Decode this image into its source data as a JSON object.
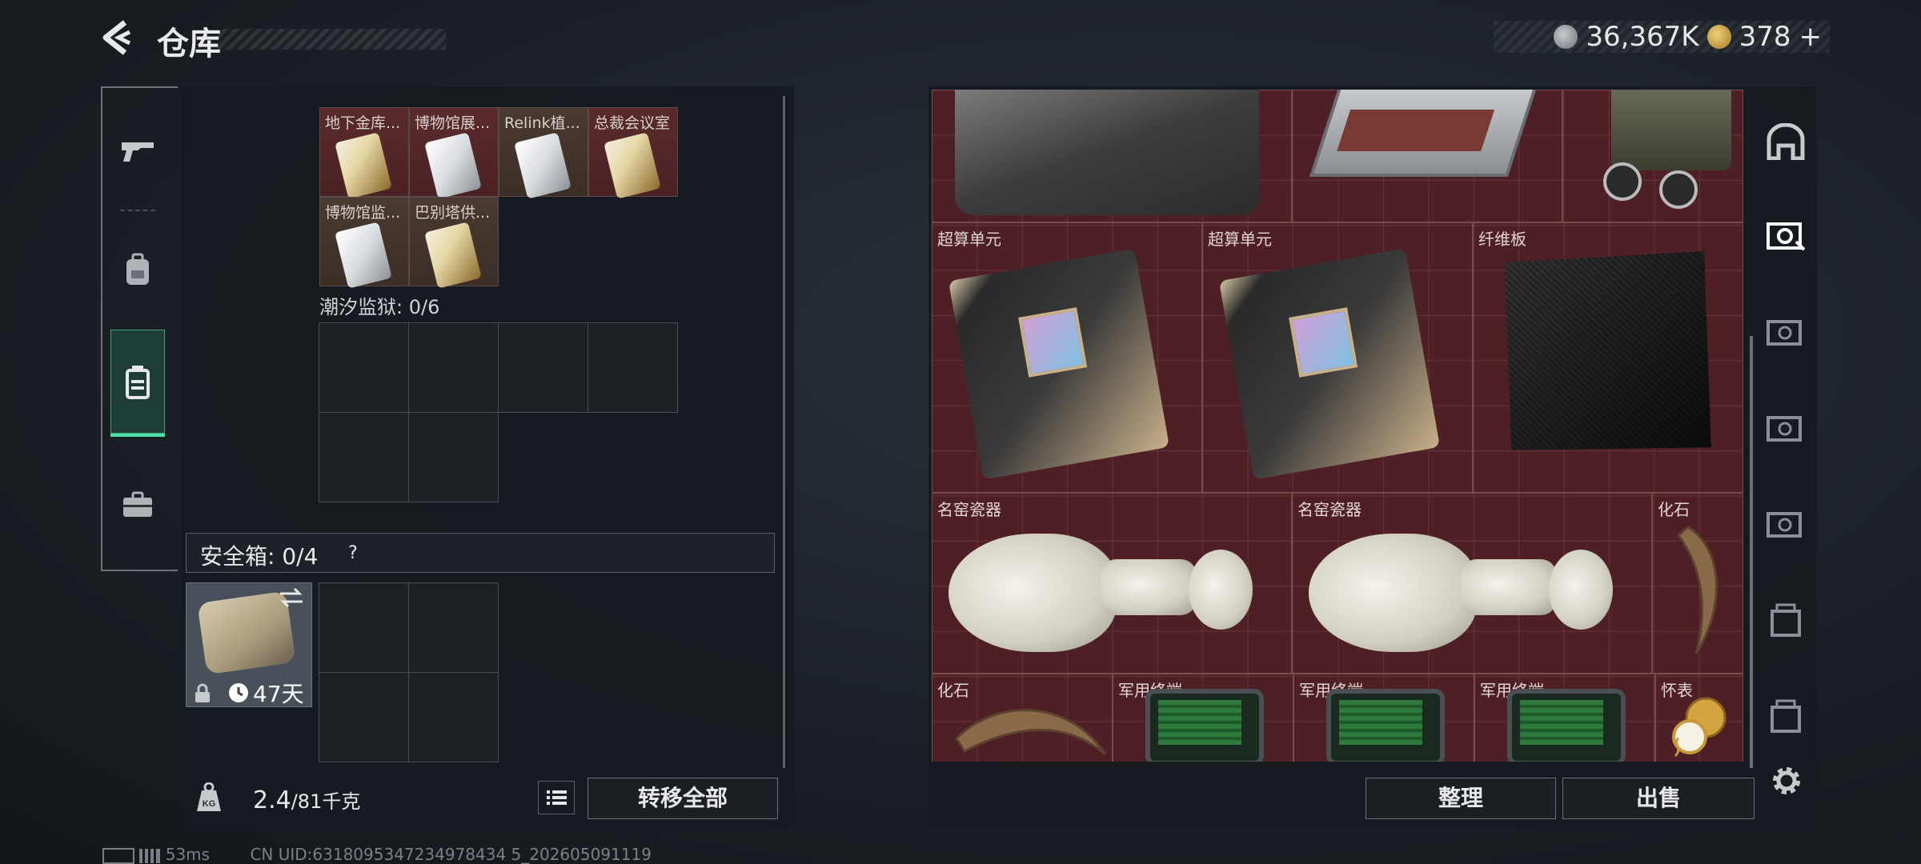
{
  "header": {
    "title": "仓库",
    "currency_1": "36,367K",
    "currency_2": "378",
    "currency_plus": "+"
  },
  "left_nav": {
    "items": [
      {
        "icon": "gun-icon"
      },
      {
        "icon": "backpack-icon"
      },
      {
        "icon": "container-icon",
        "active": true
      },
      {
        "icon": "briefcase-icon"
      }
    ]
  },
  "left_panel": {
    "key_cells": [
      {
        "label": "地下金库...",
        "card": "gold",
        "bg": "red"
      },
      {
        "label": "博物馆展...",
        "card": "silver",
        "bg": "red"
      },
      {
        "label": "Relink植...",
        "card": "silver",
        "bg": "brown"
      },
      {
        "label": "总裁会议室",
        "card": "gold",
        "bg": "red"
      },
      {
        "label": "博物馆监...",
        "card": "silver",
        "bg": "brown"
      },
      {
        "label": "巴别塔供...",
        "card": "gold",
        "bg": "brown"
      }
    ],
    "section_2_title": "潮汐监狱: 0/6",
    "safe_box_label": "安全箱: 0/4",
    "safe_box_help": "?",
    "safe_box_days": "47天",
    "weight_value": "2.4",
    "weight_max": "/81",
    "weight_unit": "千克",
    "transfer_all": "转移全部"
  },
  "stash": {
    "items": [
      {
        "label": "超算单元"
      },
      {
        "label": "超算单元"
      },
      {
        "label": "纤维板"
      },
      {
        "label": "名窑瓷器"
      },
      {
        "label": "名窑瓷器"
      },
      {
        "label": "化石"
      },
      {
        "label": "化石"
      },
      {
        "label": "军用终端"
      },
      {
        "label": "军用终端"
      },
      {
        "label": "军用终端"
      },
      {
        "label": "怀表"
      }
    ]
  },
  "buttons": {
    "sort": "整理",
    "sell": "出售"
  },
  "status": {
    "ping": "53ms",
    "uid": "CN UID:6318095347234978434 5_202605091119"
  }
}
